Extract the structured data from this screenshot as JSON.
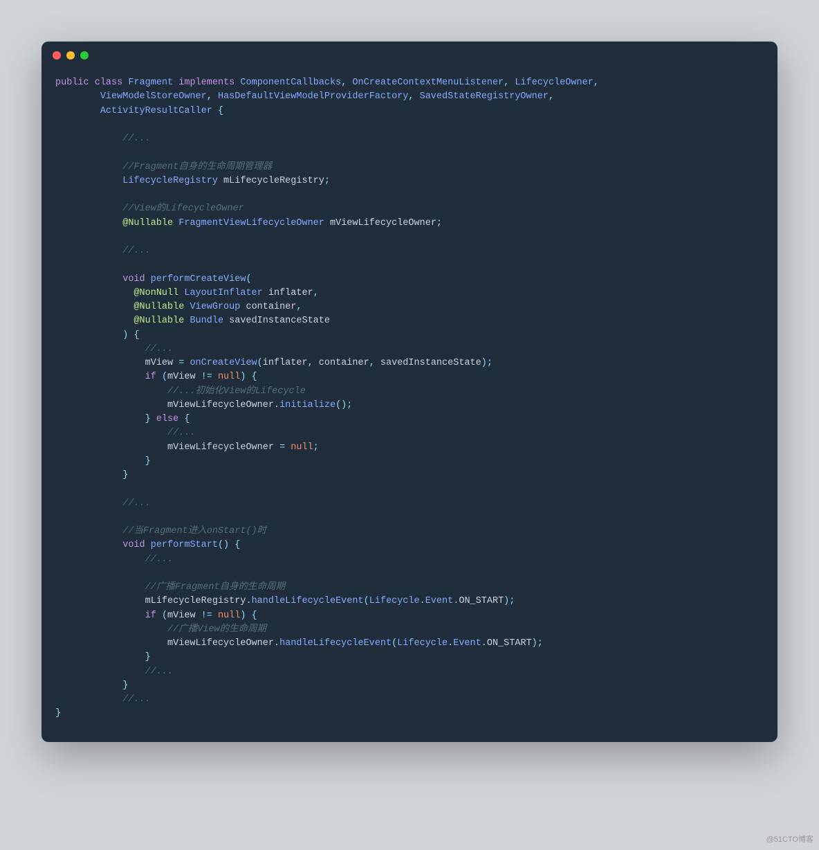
{
  "watermark": "@51CTO博客",
  "code": {
    "tokens": [
      {
        "t": "kw",
        "v": "public"
      },
      {
        "t": "t",
        "v": " "
      },
      {
        "t": "kw",
        "v": "class"
      },
      {
        "t": "t",
        "v": " "
      },
      {
        "t": "type",
        "v": "Fragment"
      },
      {
        "t": "t",
        "v": " "
      },
      {
        "t": "kw",
        "v": "implements"
      },
      {
        "t": "t",
        "v": " "
      },
      {
        "t": "type",
        "v": "ComponentCallbacks"
      },
      {
        "t": "punct",
        "v": ", "
      },
      {
        "t": "type",
        "v": "OnCreateContextMenuListener"
      },
      {
        "t": "punct",
        "v": ", "
      },
      {
        "t": "type",
        "v": "LifecycleOwner"
      },
      {
        "t": "punct",
        "v": ","
      },
      {
        "t": "nl"
      },
      {
        "t": "t",
        "v": "        "
      },
      {
        "t": "type",
        "v": "ViewModelStoreOwner"
      },
      {
        "t": "punct",
        "v": ", "
      },
      {
        "t": "type",
        "v": "HasDefaultViewModelProviderFactory"
      },
      {
        "t": "punct",
        "v": ", "
      },
      {
        "t": "type",
        "v": "SavedStateRegistryOwner"
      },
      {
        "t": "punct",
        "v": ","
      },
      {
        "t": "nl"
      },
      {
        "t": "t",
        "v": "        "
      },
      {
        "t": "type",
        "v": "ActivityResultCaller"
      },
      {
        "t": "t",
        "v": " "
      },
      {
        "t": "punct",
        "v": "{"
      },
      {
        "t": "nl"
      },
      {
        "t": "nl"
      },
      {
        "t": "t",
        "v": "            "
      },
      {
        "t": "comment",
        "v": "//..."
      },
      {
        "t": "nl"
      },
      {
        "t": "nl"
      },
      {
        "t": "t",
        "v": "            "
      },
      {
        "t": "comment",
        "v": "//Fragment自身的生命周期管理器"
      },
      {
        "t": "nl"
      },
      {
        "t": "t",
        "v": "            "
      },
      {
        "t": "type",
        "v": "LifecycleRegistry"
      },
      {
        "t": "t",
        "v": " mLifecycleRegistry"
      },
      {
        "t": "punct",
        "v": ";"
      },
      {
        "t": "nl"
      },
      {
        "t": "nl"
      },
      {
        "t": "t",
        "v": "            "
      },
      {
        "t": "comment",
        "v": "//View的LifecycleOwner"
      },
      {
        "t": "nl"
      },
      {
        "t": "t",
        "v": "            "
      },
      {
        "t": "ann",
        "v": "@Nullable"
      },
      {
        "t": "t",
        "v": " "
      },
      {
        "t": "type",
        "v": "FragmentViewLifecycleOwner"
      },
      {
        "t": "t",
        "v": " mViewLifecycleOwner"
      },
      {
        "t": "punct",
        "v": ";"
      },
      {
        "t": "nl"
      },
      {
        "t": "nl"
      },
      {
        "t": "t",
        "v": "            "
      },
      {
        "t": "comment",
        "v": "//..."
      },
      {
        "t": "nl"
      },
      {
        "t": "nl"
      },
      {
        "t": "t",
        "v": "            "
      },
      {
        "t": "kw",
        "v": "void"
      },
      {
        "t": "t",
        "v": " "
      },
      {
        "t": "method",
        "v": "performCreateView"
      },
      {
        "t": "punct",
        "v": "("
      },
      {
        "t": "nl"
      },
      {
        "t": "t",
        "v": "              "
      },
      {
        "t": "ann",
        "v": "@NonNull"
      },
      {
        "t": "t",
        "v": " "
      },
      {
        "t": "type",
        "v": "LayoutInflater"
      },
      {
        "t": "t",
        "v": " inflater"
      },
      {
        "t": "punct",
        "v": ","
      },
      {
        "t": "nl"
      },
      {
        "t": "t",
        "v": "              "
      },
      {
        "t": "ann",
        "v": "@Nullable"
      },
      {
        "t": "t",
        "v": " "
      },
      {
        "t": "type",
        "v": "ViewGroup"
      },
      {
        "t": "t",
        "v": " container"
      },
      {
        "t": "punct",
        "v": ","
      },
      {
        "t": "nl"
      },
      {
        "t": "t",
        "v": "              "
      },
      {
        "t": "ann",
        "v": "@Nullable"
      },
      {
        "t": "t",
        "v": " "
      },
      {
        "t": "type",
        "v": "Bundle"
      },
      {
        "t": "t",
        "v": " savedInstanceState"
      },
      {
        "t": "nl"
      },
      {
        "t": "t",
        "v": "            "
      },
      {
        "t": "punct",
        "v": ") {"
      },
      {
        "t": "nl"
      },
      {
        "t": "t",
        "v": "                "
      },
      {
        "t": "comment",
        "v": "//..."
      },
      {
        "t": "nl"
      },
      {
        "t": "t",
        "v": "                mView "
      },
      {
        "t": "punct",
        "v": "= "
      },
      {
        "t": "method",
        "v": "onCreateView"
      },
      {
        "t": "punct",
        "v": "("
      },
      {
        "t": "t",
        "v": "inflater"
      },
      {
        "t": "punct",
        "v": ", "
      },
      {
        "t": "t",
        "v": "container"
      },
      {
        "t": "punct",
        "v": ", "
      },
      {
        "t": "t",
        "v": "savedInstanceState"
      },
      {
        "t": "punct",
        "v": ");"
      },
      {
        "t": "nl"
      },
      {
        "t": "t",
        "v": "                "
      },
      {
        "t": "kw",
        "v": "if"
      },
      {
        "t": "t",
        "v": " "
      },
      {
        "t": "punct",
        "v": "("
      },
      {
        "t": "t",
        "v": "mView "
      },
      {
        "t": "punct",
        "v": "!= "
      },
      {
        "t": "const",
        "v": "null"
      },
      {
        "t": "punct",
        "v": ") {"
      },
      {
        "t": "nl"
      },
      {
        "t": "t",
        "v": "                    "
      },
      {
        "t": "comment",
        "v": "//...初始化View的Lifecycle"
      },
      {
        "t": "nl"
      },
      {
        "t": "t",
        "v": "                    mViewLifecycleOwner"
      },
      {
        "t": "punct",
        "v": "."
      },
      {
        "t": "method",
        "v": "initialize"
      },
      {
        "t": "punct",
        "v": "();"
      },
      {
        "t": "nl"
      },
      {
        "t": "t",
        "v": "                "
      },
      {
        "t": "punct",
        "v": "} "
      },
      {
        "t": "kw",
        "v": "else"
      },
      {
        "t": "t",
        "v": " "
      },
      {
        "t": "punct",
        "v": "{"
      },
      {
        "t": "nl"
      },
      {
        "t": "t",
        "v": "                    "
      },
      {
        "t": "comment",
        "v": "//..."
      },
      {
        "t": "nl"
      },
      {
        "t": "t",
        "v": "                    mViewLifecycleOwner "
      },
      {
        "t": "punct",
        "v": "= "
      },
      {
        "t": "const",
        "v": "null"
      },
      {
        "t": "punct",
        "v": ";"
      },
      {
        "t": "nl"
      },
      {
        "t": "t",
        "v": "                "
      },
      {
        "t": "punct",
        "v": "}"
      },
      {
        "t": "nl"
      },
      {
        "t": "t",
        "v": "            "
      },
      {
        "t": "punct",
        "v": "}"
      },
      {
        "t": "nl"
      },
      {
        "t": "nl"
      },
      {
        "t": "t",
        "v": "            "
      },
      {
        "t": "comment",
        "v": "//..."
      },
      {
        "t": "nl"
      },
      {
        "t": "nl"
      },
      {
        "t": "t",
        "v": "            "
      },
      {
        "t": "comment",
        "v": "//当Fragment进入onStart()时"
      },
      {
        "t": "nl"
      },
      {
        "t": "t",
        "v": "            "
      },
      {
        "t": "kw",
        "v": "void"
      },
      {
        "t": "t",
        "v": " "
      },
      {
        "t": "method",
        "v": "performStart"
      },
      {
        "t": "punct",
        "v": "() {"
      },
      {
        "t": "nl"
      },
      {
        "t": "t",
        "v": "                "
      },
      {
        "t": "comment",
        "v": "//..."
      },
      {
        "t": "nl"
      },
      {
        "t": "nl"
      },
      {
        "t": "t",
        "v": "                "
      },
      {
        "t": "comment",
        "v": "//广播Fragment自身的生命周期"
      },
      {
        "t": "nl"
      },
      {
        "t": "t",
        "v": "                mLifecycleRegistry"
      },
      {
        "t": "punct",
        "v": "."
      },
      {
        "t": "method",
        "v": "handleLifecycleEvent"
      },
      {
        "t": "punct",
        "v": "("
      },
      {
        "t": "type",
        "v": "Lifecycle"
      },
      {
        "t": "punct",
        "v": "."
      },
      {
        "t": "type",
        "v": "Event"
      },
      {
        "t": "punct",
        "v": "."
      },
      {
        "t": "t",
        "v": "ON_START"
      },
      {
        "t": "punct",
        "v": ");"
      },
      {
        "t": "nl"
      },
      {
        "t": "t",
        "v": "                "
      },
      {
        "t": "kw",
        "v": "if"
      },
      {
        "t": "t",
        "v": " "
      },
      {
        "t": "punct",
        "v": "("
      },
      {
        "t": "t",
        "v": "mView "
      },
      {
        "t": "punct",
        "v": "!= "
      },
      {
        "t": "const",
        "v": "null"
      },
      {
        "t": "punct",
        "v": ") {"
      },
      {
        "t": "nl"
      },
      {
        "t": "t",
        "v": "                    "
      },
      {
        "t": "comment",
        "v": "//广播View的生命周期"
      },
      {
        "t": "nl"
      },
      {
        "t": "t",
        "v": "                    mViewLifecycleOwner"
      },
      {
        "t": "punct",
        "v": "."
      },
      {
        "t": "method",
        "v": "handleLifecycleEvent"
      },
      {
        "t": "punct",
        "v": "("
      },
      {
        "t": "type",
        "v": "Lifecycle"
      },
      {
        "t": "punct",
        "v": "."
      },
      {
        "t": "type",
        "v": "Event"
      },
      {
        "t": "punct",
        "v": "."
      },
      {
        "t": "t",
        "v": "ON_START"
      },
      {
        "t": "punct",
        "v": ");"
      },
      {
        "t": "nl"
      },
      {
        "t": "t",
        "v": "                "
      },
      {
        "t": "punct",
        "v": "}"
      },
      {
        "t": "nl"
      },
      {
        "t": "t",
        "v": "                "
      },
      {
        "t": "comment",
        "v": "//..."
      },
      {
        "t": "nl"
      },
      {
        "t": "t",
        "v": "            "
      },
      {
        "t": "punct",
        "v": "}"
      },
      {
        "t": "nl"
      },
      {
        "t": "t",
        "v": "            "
      },
      {
        "t": "comment",
        "v": "//..."
      },
      {
        "t": "nl"
      },
      {
        "t": "punct",
        "v": "}"
      }
    ]
  }
}
